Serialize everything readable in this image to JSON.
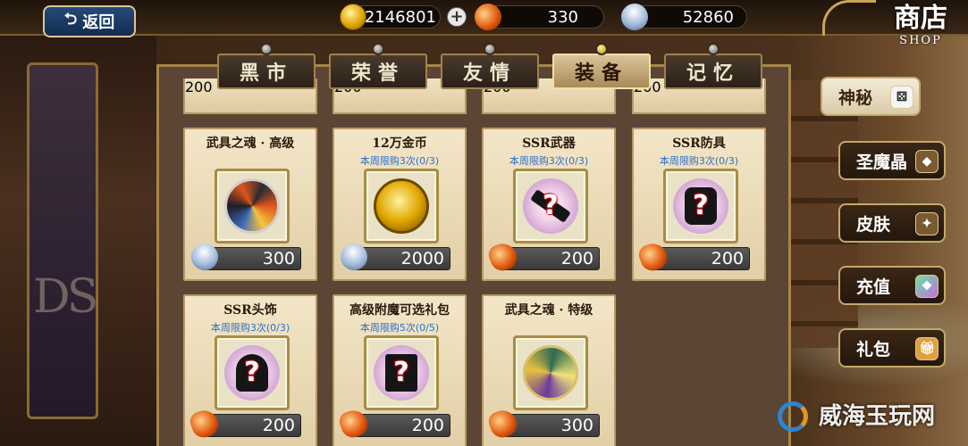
{
  "header": {
    "back_label": "返回",
    "gold": "2146801",
    "rubies": "330",
    "crystals": "52860",
    "title_cn": "商店",
    "title_en": "SHOP"
  },
  "tabs": [
    {
      "label": "黑市",
      "active": false
    },
    {
      "label": "荣誉",
      "active": false
    },
    {
      "label": "友情",
      "active": false
    },
    {
      "label": "装备",
      "active": true
    },
    {
      "label": "记忆",
      "active": false
    }
  ],
  "top_row_prices": [
    "200",
    "200",
    "200",
    "200"
  ],
  "items": [
    {
      "name": "武具之魂 · 高级",
      "limit": "",
      "price": "300",
      "currency": "crystal",
      "art": "soul-hi"
    },
    {
      "name": "12万金币",
      "limit": "本周限购3次(0/3)",
      "price": "2000",
      "currency": "crystal",
      "art": "coins"
    },
    {
      "name": "SSR武器",
      "limit": "本周限购3次(0/3)",
      "price": "200",
      "currency": "ruby",
      "art": "weapon"
    },
    {
      "name": "SSR防具",
      "limit": "本周限购3次(0/3)",
      "price": "200",
      "currency": "ruby",
      "art": "armor"
    },
    {
      "name": "SSR头饰",
      "limit": "本周限购3次(0/3)",
      "price": "200",
      "currency": "ruby",
      "art": "helm"
    },
    {
      "name": "高级附魔可选礼包",
      "limit": "本周限购5次(0/5)",
      "price": "200",
      "currency": "ruby",
      "art": "scroll"
    },
    {
      "name": "武具之魂 · 特级",
      "limit": "",
      "price": "300",
      "currency": "ruby",
      "art": "soul-sp"
    }
  ],
  "side_menu": [
    {
      "label": "神秘",
      "active": true,
      "icon": "dice-icon"
    },
    {
      "label": "圣魔晶",
      "active": false,
      "icon": "crystal-badge-icon"
    },
    {
      "label": "皮肤",
      "active": false,
      "icon": "skin-icon"
    },
    {
      "label": "充值",
      "active": false,
      "icon": "gem-pack-icon"
    },
    {
      "label": "礼包",
      "active": false,
      "icon": "gift-icon"
    }
  ],
  "watermark": "威海玉玩网"
}
